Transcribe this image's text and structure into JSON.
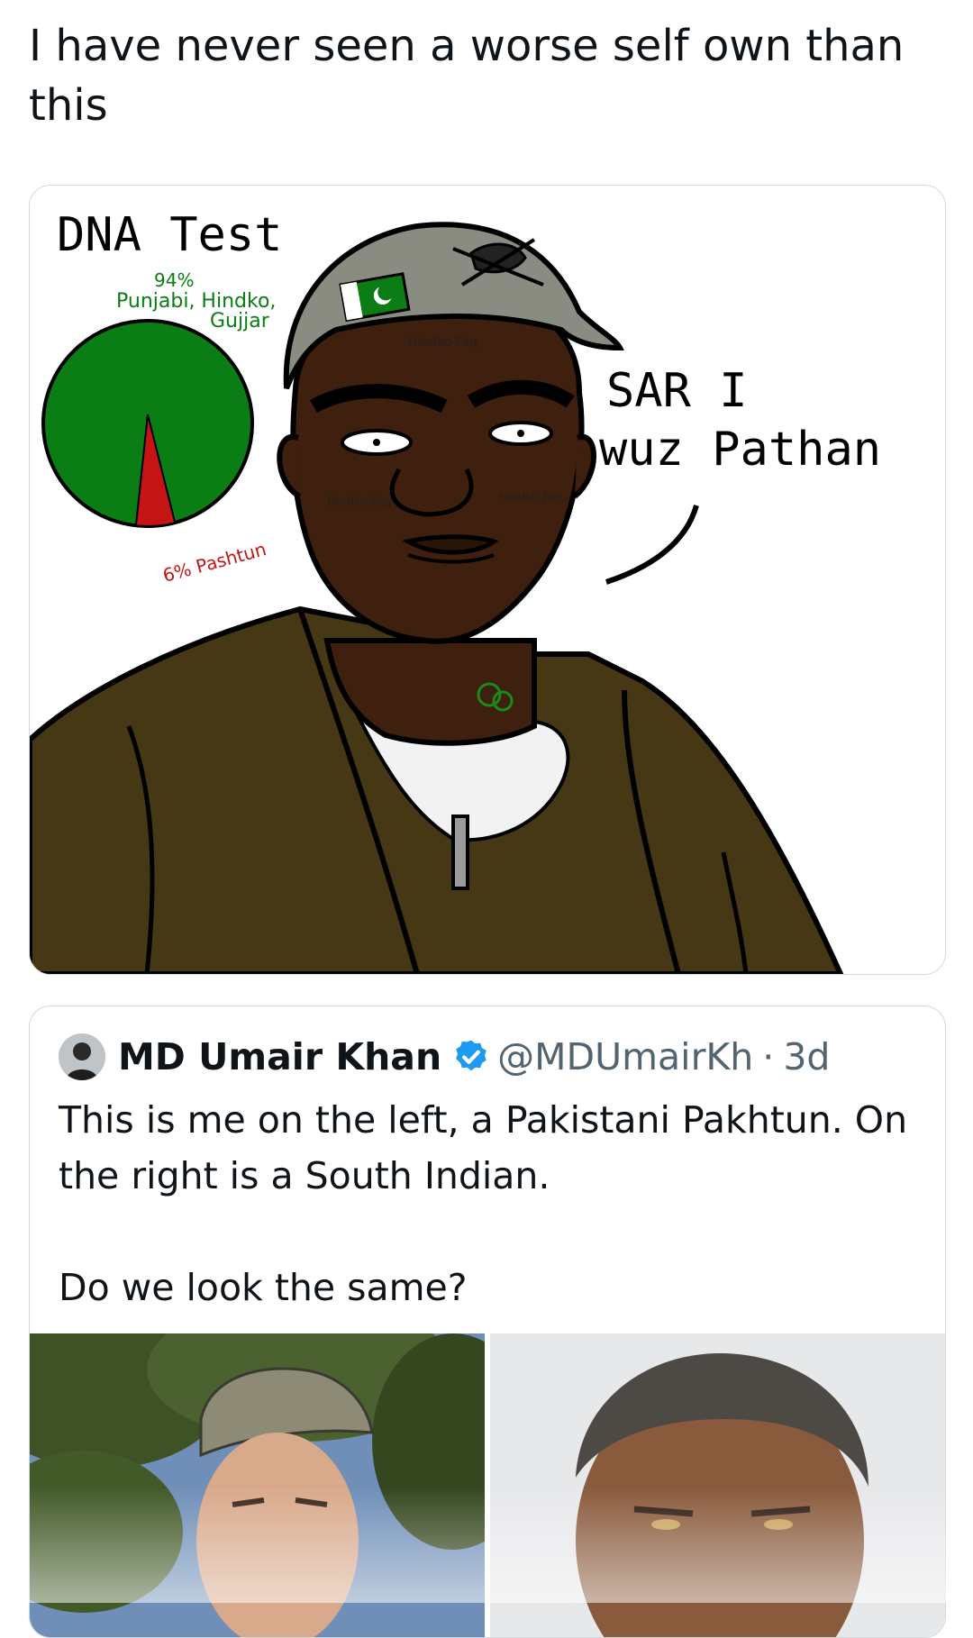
{
  "post": {
    "text": "I have never seen a worse self own than this"
  },
  "cartoon": {
    "title": "DNA Test",
    "majority_label_pct": "94%",
    "majority_label_line1": "Punjabi, Hindko,",
    "majority_label_line2": "Gujjar",
    "minority_label": "6% Pashtun",
    "speech_line1": "SAR I",
    "speech_line2": "wuz Pathan",
    "forehead_label": "Hindko Fag",
    "cheek_left_label": "Hindko Fag",
    "cheek_right_label": "Hindko Fag",
    "pie": {
      "green_pct": 94,
      "red_pct": 6,
      "green": "#0a7d14",
      "red": "#c41414"
    },
    "colors": {
      "skin": "#3f1f0d",
      "jacket": "#463814",
      "cap": "#8a8c82"
    }
  },
  "quote": {
    "author_name": "MD Umair Khan",
    "handle": "@MDUmairKh",
    "separator": "·",
    "time": "3d",
    "text_para1": "This is me on the left, a Pakistani Pakhtun. On the right is a South Indian.",
    "text_para2": "Do we look the same?",
    "verified_color": "#1d9bf0"
  },
  "icons": [
    "verified-badge-icon"
  ]
}
